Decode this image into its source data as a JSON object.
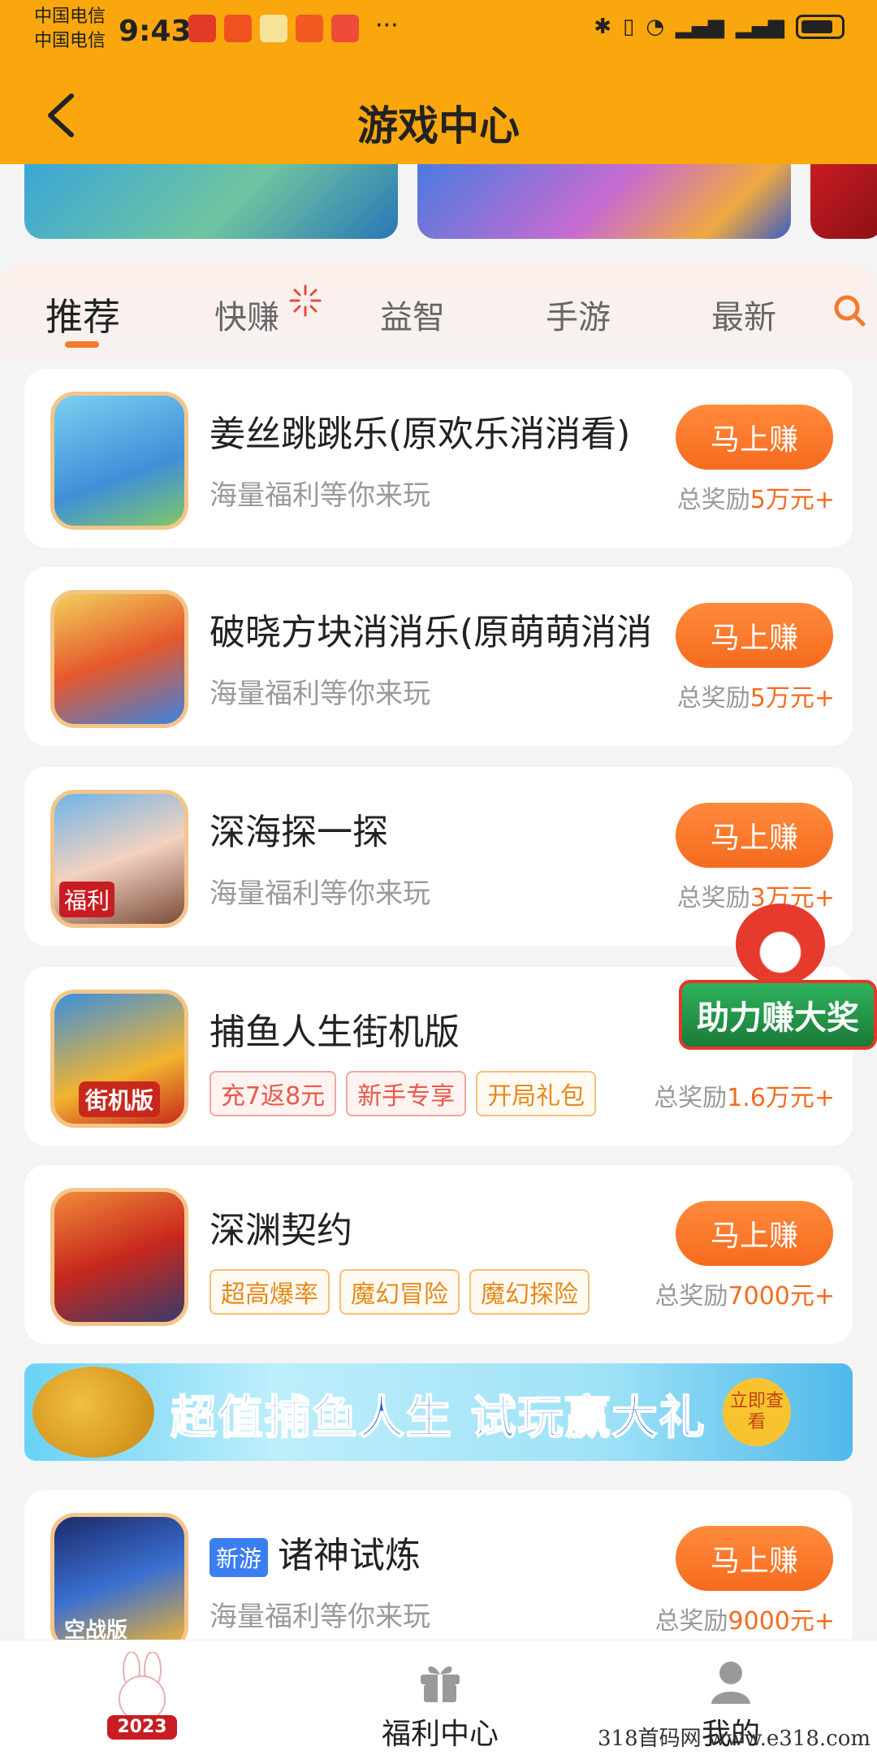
{
  "status_bar": {
    "carrier1": "中国电信",
    "carrier2": "中国电信",
    "time": "9:43",
    "more": "···"
  },
  "nav": {
    "title": "游戏中心",
    "back_icon": "back-arrow-icon"
  },
  "tabs": [
    {
      "label": "推荐",
      "active": true
    },
    {
      "label": "快赚",
      "active": false
    },
    {
      "label": "益智",
      "active": false
    },
    {
      "label": "手游",
      "active": false
    },
    {
      "label": "最新",
      "active": false
    }
  ],
  "games": [
    {
      "name": "姜丝跳跳乐(原欢乐消消看)",
      "subtitle": "海量福利等你来玩",
      "button": "马上赚",
      "reward_prefix": "总奖励",
      "reward_amount": "5万元+"
    },
    {
      "name": "破晓方块消消乐(原萌萌消消",
      "subtitle": "海量福利等你来玩",
      "button": "马上赚",
      "reward_prefix": "总奖励",
      "reward_amount": "5万元+"
    },
    {
      "name": "深海探一探",
      "subtitle": "海量福利等你来玩",
      "button": "马上赚",
      "reward_prefix": "总奖励",
      "reward_amount": "3万元+"
    },
    {
      "name": "捕鱼人生街机版",
      "tags": [
        "充7返8元",
        "新手专享",
        "开局礼包"
      ],
      "reward_prefix": "总奖励",
      "reward_amount": "1.6万元+"
    },
    {
      "name": "深渊契约",
      "tags": [
        "超高爆率",
        "魔幻冒险",
        "魔幻探险"
      ],
      "button": "马上赚",
      "reward_prefix": "总奖励",
      "reward_amount": "7000元+"
    },
    {
      "name": "诸神试炼",
      "badge": "新游",
      "subtitle": "海量福利等你来玩",
      "button": "马上赚",
      "reward_prefix": "总奖励",
      "reward_amount": "9000元+"
    }
  ],
  "icon_labels": {
    "icon3": "福利",
    "icon4": "街机版",
    "icon6": "空战版"
  },
  "promo": {
    "text": "超值捕鱼人生 试玩赢大礼",
    "cta": "立即查看"
  },
  "float_event": {
    "label": "助力赚大奖"
  },
  "bottom_nav": {
    "rabbit_year": "2023",
    "welfare": "福利中心",
    "me": "我的"
  },
  "watermark": "318首码网 www.e318.com",
  "colors": {
    "header": "#f9a70c",
    "accent": "#f56b1e",
    "tag_red": "#e85a4a",
    "tag_orange": "#e58a1c",
    "new_badge": "#3a7ef0"
  }
}
